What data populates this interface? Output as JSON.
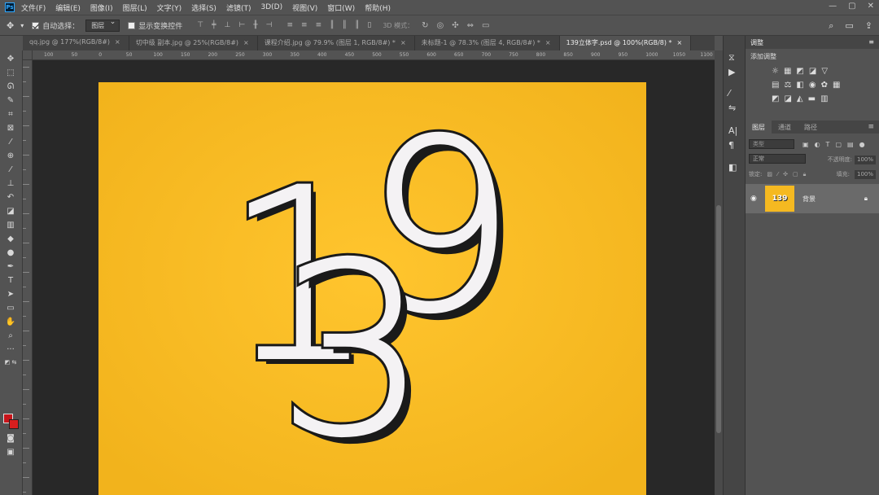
{
  "menubar": {
    "logo": "Ps",
    "items": [
      "文件(F)",
      "编辑(E)",
      "图像(I)",
      "图层(L)",
      "文字(Y)",
      "选择(S)",
      "滤镜(T)",
      "3D(D)",
      "视图(V)",
      "窗口(W)",
      "帮助(H)"
    ]
  },
  "options": {
    "auto_select_label": "自动选择：",
    "auto_select_target": "图层",
    "show_transform_label": "显示变换控件",
    "mode_3d_label": "3D 模式："
  },
  "tabs": [
    {
      "label": "qq.jpg @ 177%(RGB/8#)"
    },
    {
      "label": "切中级   副本.jpg @ 25%(RGB/8#)"
    },
    {
      "label": "课程介绍.jpg @ 79.9% (图层 1, RGB/8#) *"
    },
    {
      "label": "未标题-1 @ 78.3% (图层 4, RGB/8#) *"
    },
    {
      "label": "139立体字.psd @ 100%(RGB/8) *",
      "active": true
    }
  ],
  "ruler": {
    "labels": [
      "100",
      "50",
      "0",
      "50",
      "100",
      "150",
      "200",
      "250",
      "300",
      "350",
      "400",
      "450",
      "500",
      "550",
      "600",
      "650",
      "700",
      "750",
      "800",
      "850",
      "900",
      "950",
      "1000",
      "1050",
      "1100"
    ]
  },
  "panels": {
    "adjustments_tab": "调整",
    "add_adjustment_label": "添加调整",
    "layers_tab": "图层",
    "channels_tab": "通道",
    "paths_tab": "路径",
    "kind_filter_placeholder": "类型",
    "blend_mode": "正常",
    "opacity_label": "不透明度:",
    "opacity_value": "100%",
    "lock_label": "锁定:",
    "fill_label": "填充:",
    "fill_value": "100%"
  },
  "layer": {
    "name": "背景",
    "thumb_text": "139"
  },
  "canvas": {
    "digits": [
      "1",
      "3",
      "9"
    ],
    "bg_color": "#f5b921",
    "letter_fill": "#f4f2f4",
    "letter_outline": "#1a1a1a"
  },
  "colors": {
    "foreground": "#c8141a",
    "background": "#d81e1e"
  }
}
